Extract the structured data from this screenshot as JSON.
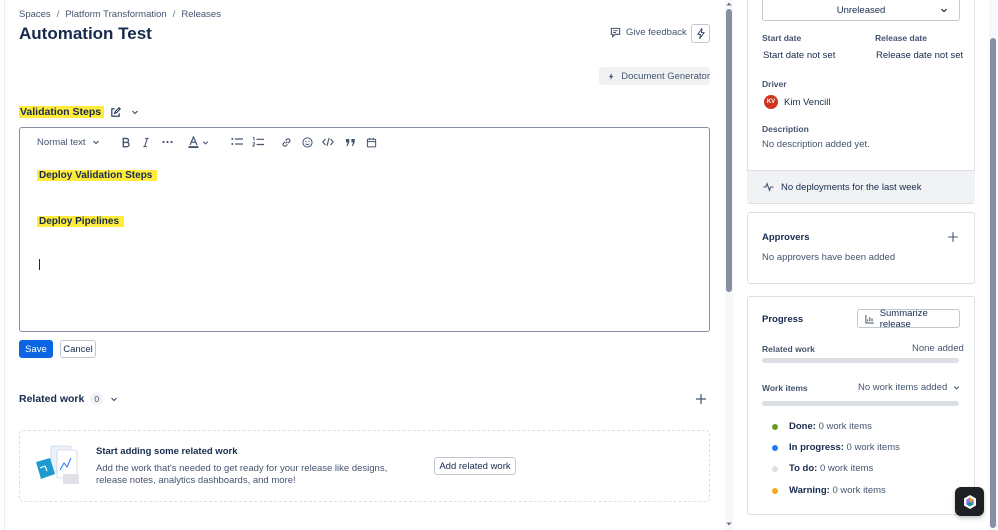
{
  "breadcrumb": [
    "Spaces",
    "Platform Transformation",
    "Releases"
  ],
  "page_title": "Automation Test",
  "header": {
    "feedback_label": "Give feedback",
    "doc_generator_label": "Document Generator"
  },
  "section": {
    "title": "Validation Steps"
  },
  "editor": {
    "text_style": "Normal text",
    "lines": [
      "Deploy Validation Steps",
      "Deploy Pipelines"
    ]
  },
  "actions": {
    "save": "Save",
    "cancel": "Cancel"
  },
  "related_work": {
    "title": "Related work",
    "count": "0",
    "empty_title": "Start adding some related work",
    "empty_desc": "Add the work that's needed to get ready for your release like designs, release notes, analytics dashboards, and more!",
    "add_label": "Add related work"
  },
  "details": {
    "status": "Unreleased",
    "start_date_label": "Start date",
    "start_date_value": "Start date not set",
    "release_date_label": "Release date",
    "release_date_value": "Release date not set",
    "driver_label": "Driver",
    "driver_initials": "KV",
    "driver_name": "Kim Vencill",
    "description_label": "Description",
    "description_value": "No description added yet.",
    "deployments": "No deployments for the last week"
  },
  "approvers": {
    "title": "Approvers",
    "empty": "No approvers have been added"
  },
  "progress": {
    "title": "Progress",
    "summarize_label": "Summarize release",
    "related_work_label": "Related work",
    "related_work_value": "None added",
    "work_items_label": "Work items",
    "work_items_value": "No work items added",
    "legend": [
      {
        "label": "Done:",
        "value": "0 work items",
        "color": "#6a9a23"
      },
      {
        "label": "In progress:",
        "value": "0 work items",
        "color": "#1d7afc"
      },
      {
        "label": "To do:",
        "value": "0 work items",
        "color": "#dcdfe4"
      },
      {
        "label": "Warning:",
        "value": "0 work items",
        "color": "#f5a623"
      }
    ]
  },
  "colors": {
    "highlight": "#ffeb3b",
    "primary": "#0c66e4"
  }
}
